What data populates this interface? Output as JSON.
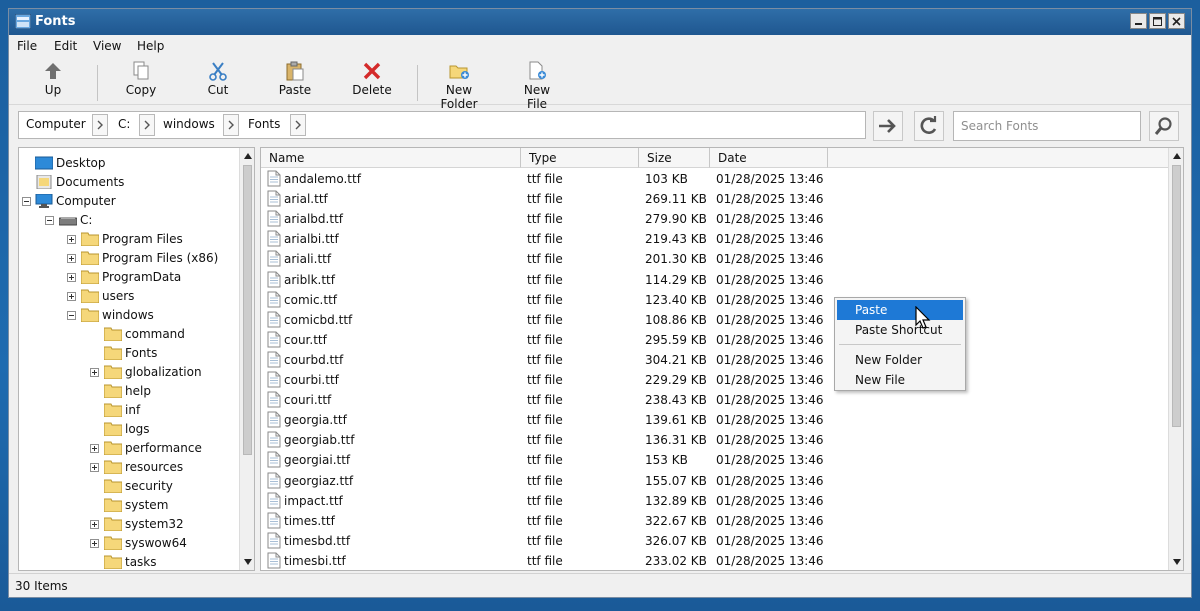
{
  "window": {
    "title": "Fonts",
    "controls": [
      "minimize",
      "maximize",
      "close"
    ]
  },
  "menu": {
    "items": [
      "File",
      "Edit",
      "View",
      "Help"
    ]
  },
  "toolbar": {
    "up": "Up",
    "copy": "Copy",
    "cut": "Cut",
    "paste": "Paste",
    "delete": "Delete",
    "new_folder": "New Folder",
    "new_file": "New File"
  },
  "breadcrumb": [
    "Computer",
    "C:",
    "windows",
    "Fonts"
  ],
  "search": {
    "placeholder": "Search Fonts"
  },
  "tree": {
    "desktop": "Desktop",
    "documents": "Documents",
    "computer": "Computer",
    "drive": "C:",
    "c_children": [
      "Program Files",
      "Program Files (x86)",
      "ProgramData",
      "users",
      "windows"
    ],
    "windows_children": [
      "command",
      "Fonts",
      "globalization",
      "help",
      "inf",
      "logs",
      "performance",
      "resources",
      "security",
      "system",
      "system32",
      "syswow64",
      "tasks"
    ]
  },
  "columns": [
    "Name",
    "Type",
    "Size",
    "Date"
  ],
  "files": [
    {
      "name": "andalemo.ttf",
      "type": "ttf file",
      "size": "103 KB",
      "date": "01/28/2025 13:46"
    },
    {
      "name": "arial.ttf",
      "type": "ttf file",
      "size": "269.11 KB",
      "date": "01/28/2025 13:46"
    },
    {
      "name": "arialbd.ttf",
      "type": "ttf file",
      "size": "279.90 KB",
      "date": "01/28/2025 13:46"
    },
    {
      "name": "arialbi.ttf",
      "type": "ttf file",
      "size": "219.43 KB",
      "date": "01/28/2025 13:46"
    },
    {
      "name": "ariali.ttf",
      "type": "ttf file",
      "size": "201.30 KB",
      "date": "01/28/2025 13:46"
    },
    {
      "name": "ariblk.ttf",
      "type": "ttf file",
      "size": "114.29 KB",
      "date": "01/28/2025 13:46"
    },
    {
      "name": "comic.ttf",
      "type": "ttf file",
      "size": "123.40 KB",
      "date": "01/28/2025 13:46"
    },
    {
      "name": "comicbd.ttf",
      "type": "ttf file",
      "size": "108.86 KB",
      "date": "01/28/2025 13:46"
    },
    {
      "name": "cour.ttf",
      "type": "ttf file",
      "size": "295.59 KB",
      "date": "01/28/2025 13:46"
    },
    {
      "name": "courbd.ttf",
      "type": "ttf file",
      "size": "304.21 KB",
      "date": "01/28/2025 13:46"
    },
    {
      "name": "courbi.ttf",
      "type": "ttf file",
      "size": "229.29 KB",
      "date": "01/28/2025 13:46"
    },
    {
      "name": "couri.ttf",
      "type": "ttf file",
      "size": "238.43 KB",
      "date": "01/28/2025 13:46"
    },
    {
      "name": "georgia.ttf",
      "type": "ttf file",
      "size": "139.61 KB",
      "date": "01/28/2025 13:46"
    },
    {
      "name": "georgiab.ttf",
      "type": "ttf file",
      "size": "136.31 KB",
      "date": "01/28/2025 13:46"
    },
    {
      "name": "georgiai.ttf",
      "type": "ttf file",
      "size": "153 KB",
      "date": "01/28/2025 13:46"
    },
    {
      "name": "georgiaz.ttf",
      "type": "ttf file",
      "size": "155.07 KB",
      "date": "01/28/2025 13:46"
    },
    {
      "name": "impact.ttf",
      "type": "ttf file",
      "size": "132.89 KB",
      "date": "01/28/2025 13:46"
    },
    {
      "name": "times.ttf",
      "type": "ttf file",
      "size": "322.67 KB",
      "date": "01/28/2025 13:46"
    },
    {
      "name": "timesbd.ttf",
      "type": "ttf file",
      "size": "326.07 KB",
      "date": "01/28/2025 13:46"
    },
    {
      "name": "timesbi.ttf",
      "type": "ttf file",
      "size": "233.02 KB",
      "date": "01/28/2025 13:46"
    }
  ],
  "context_menu": {
    "items": [
      "Paste",
      "Paste Shortcut",
      "New Folder",
      "New File"
    ],
    "highlighted": "Paste"
  },
  "status": {
    "text": "30 Items"
  },
  "colors": {
    "titlebar": "#1f5790",
    "selection": "#1e79d6",
    "folder": "#f5d77a",
    "delete_red": "#d42a2a",
    "desktop_blue": "#2d8ad8"
  },
  "icons": [
    "up-arrow-icon",
    "copy-icon",
    "cut-icon",
    "paste-icon",
    "delete-icon",
    "new-folder-icon",
    "new-file-icon",
    "go-arrow-icon",
    "refresh-icon",
    "search-icon",
    "folder-icon",
    "drive-icon",
    "computer-icon",
    "desktop-icon",
    "documents-icon",
    "file-icon"
  ]
}
